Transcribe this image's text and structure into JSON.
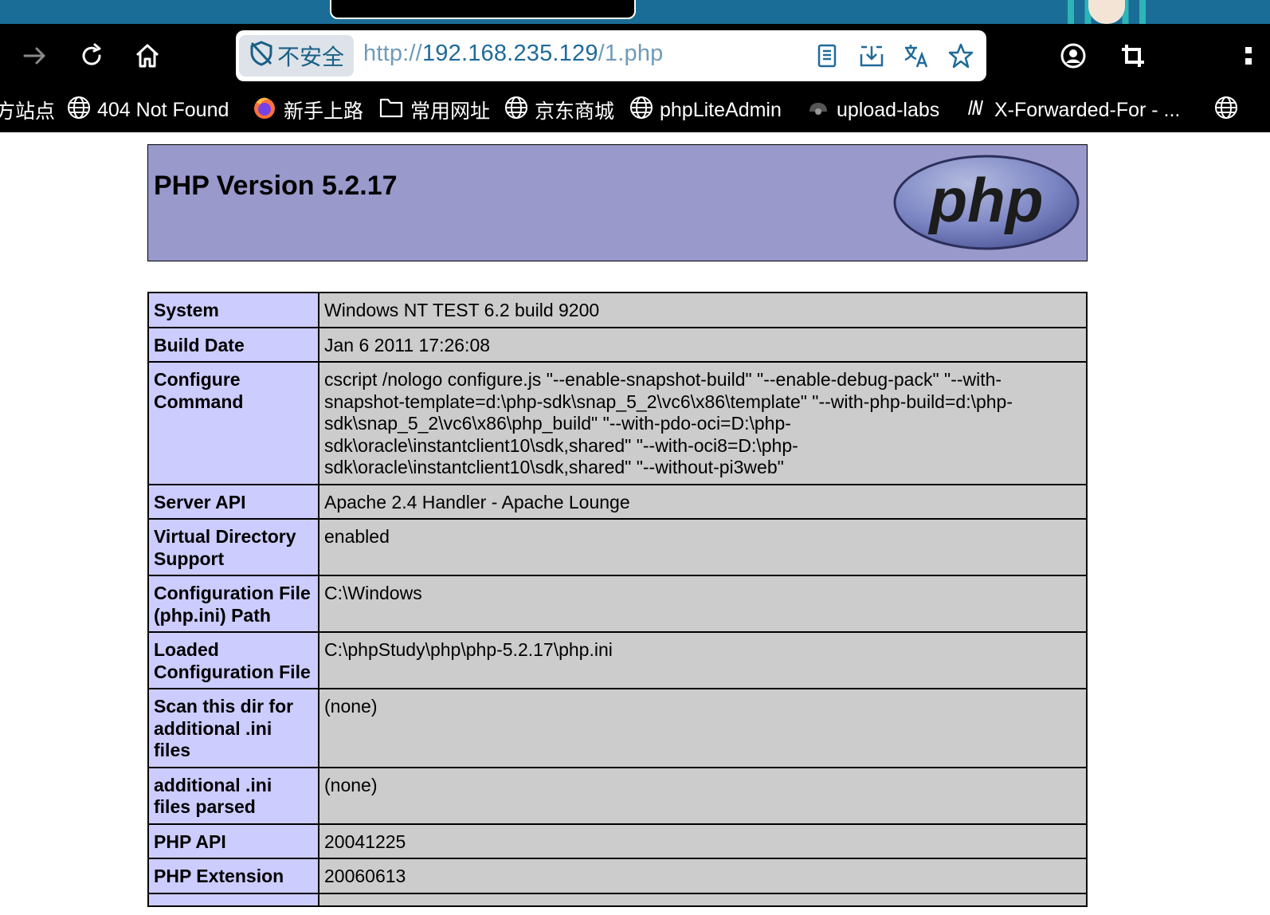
{
  "browser": {
    "security_label": "不安全",
    "url": {
      "scheme": "http://",
      "host": "192.168.235.129",
      "path": "/1.php"
    },
    "bookmarks": [
      {
        "icon": "globe-icon",
        "label": "方站点"
      },
      {
        "icon": "globe-icon",
        "label": "404 Not Found"
      },
      {
        "icon": "firefox-icon",
        "label": "新手上路"
      },
      {
        "icon": "folder-icon",
        "label": "常用网址"
      },
      {
        "icon": "globe-icon",
        "label": "京东商城"
      },
      {
        "icon": "globe-icon",
        "label": "phpLiteAdmin"
      },
      {
        "icon": "car-icon",
        "label": "upload-labs"
      },
      {
        "icon": "m-logo-icon",
        "label": "X-Forwarded-For - ..."
      }
    ]
  },
  "page": {
    "title": "PHP Version 5.2.17",
    "logo_text": "php",
    "rows": [
      {
        "key": "System",
        "value": "Windows NT TEST 6.2 build 9200"
      },
      {
        "key": "Build Date",
        "value": "Jan 6 2011 17:26:08"
      },
      {
        "key": "Configure Command",
        "value": "cscript /nologo configure.js \"--enable-snapshot-build\" \"--enable-debug-pack\" \"--with-snapshot-template=d:\\php-sdk\\snap_5_2\\vc6\\x86\\template\" \"--with-php-build=d:\\php-sdk\\snap_5_2\\vc6\\x86\\php_build\" \"--with-pdo-oci=D:\\php-sdk\\oracle\\instantclient10\\sdk,shared\" \"--with-oci8=D:\\php-sdk\\oracle\\instantclient10\\sdk,shared\" \"--without-pi3web\""
      },
      {
        "key": "Server API",
        "value": "Apache 2.4 Handler - Apache Lounge"
      },
      {
        "key": "Virtual Directory Support",
        "value": "enabled"
      },
      {
        "key": "Configuration File (php.ini) Path",
        "value": "C:\\Windows"
      },
      {
        "key": "Loaded Configuration File",
        "value": "C:\\phpStudy\\php\\php-5.2.17\\php.ini"
      },
      {
        "key": "Scan this dir for additional .ini files",
        "value": "(none)"
      },
      {
        "key": "additional .ini files parsed",
        "value": "(none)"
      },
      {
        "key": "PHP API",
        "value": "20041225"
      },
      {
        "key": "PHP Extension",
        "value": "20060613"
      },
      {
        "key": "",
        "value": ""
      }
    ]
  },
  "colors": {
    "header_bg": "#9999cc",
    "key_bg": "#ccccff",
    "value_bg": "#cccccc",
    "browser_chrome": "#000000",
    "url_host": "#1f6a99"
  }
}
